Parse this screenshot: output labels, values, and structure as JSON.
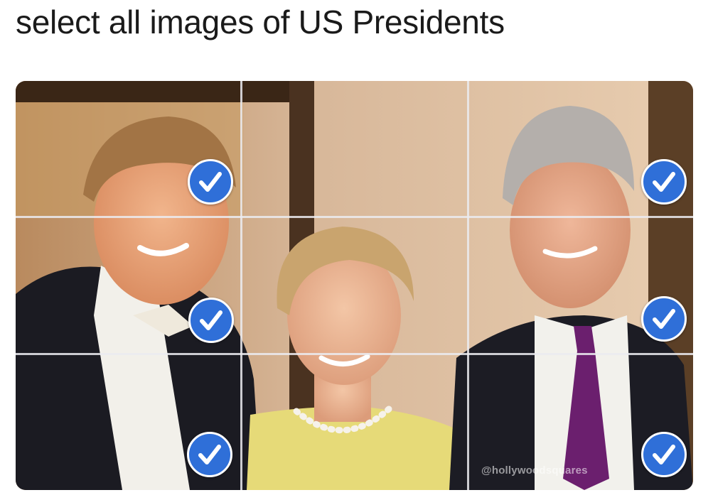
{
  "prompt": {
    "text": "select all images of US Presidents"
  },
  "grid": {
    "rows": 3,
    "cols": 3,
    "tiles": [
      {
        "row": 0,
        "col": 0,
        "selected": true
      },
      {
        "row": 0,
        "col": 1,
        "selected": false
      },
      {
        "row": 0,
        "col": 2,
        "selected": true
      },
      {
        "row": 1,
        "col": 0,
        "selected": true
      },
      {
        "row": 1,
        "col": 1,
        "selected": false
      },
      {
        "row": 1,
        "col": 2,
        "selected": true
      },
      {
        "row": 2,
        "col": 0,
        "selected": true
      },
      {
        "row": 2,
        "col": 1,
        "selected": false
      },
      {
        "row": 2,
        "col": 2,
        "selected": true
      }
    ]
  },
  "watermark": {
    "text": "@hollywoodsquares"
  },
  "colors": {
    "check_fill": "#2f6fd8",
    "check_ring": "#ffffff",
    "grid_lines": "#ebebf0"
  },
  "icons": {
    "selected_marker": "checkmark-icon"
  }
}
